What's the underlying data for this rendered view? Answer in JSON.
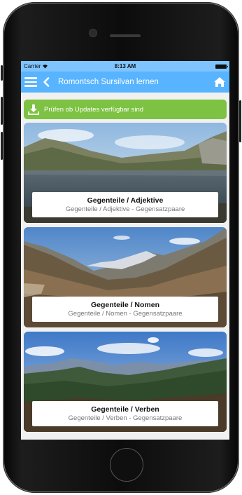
{
  "status_bar": {
    "carrier": "Carrier",
    "time": "8:13 AM"
  },
  "nav": {
    "title": "Romontsch Sursilvan lernen",
    "menu_icon": "hamburger-menu-icon",
    "back_icon": "chevron-left-icon",
    "home_icon": "home-icon"
  },
  "update_bar": {
    "label": "Prüfen ob Updates verfügbar sind",
    "icon": "download-icon",
    "color": "#7dc242"
  },
  "cards": [
    {
      "title": "Gegenteile / Adjektive",
      "subtitle": "Gegenteile / Adjektive - Gegensatzpaare"
    },
    {
      "title": "Gegenteile / Nomen",
      "subtitle": "Gegenteile / Nomen - Gegensatzpaare"
    },
    {
      "title": "Gegenteile / Verben",
      "subtitle": "Gegenteile / Verben - Gegensatzpaare"
    }
  ],
  "colors": {
    "status_bar": "#7fc4ff",
    "nav_bar": "#58b4ff",
    "screen_bg": "#f1f1f1"
  }
}
